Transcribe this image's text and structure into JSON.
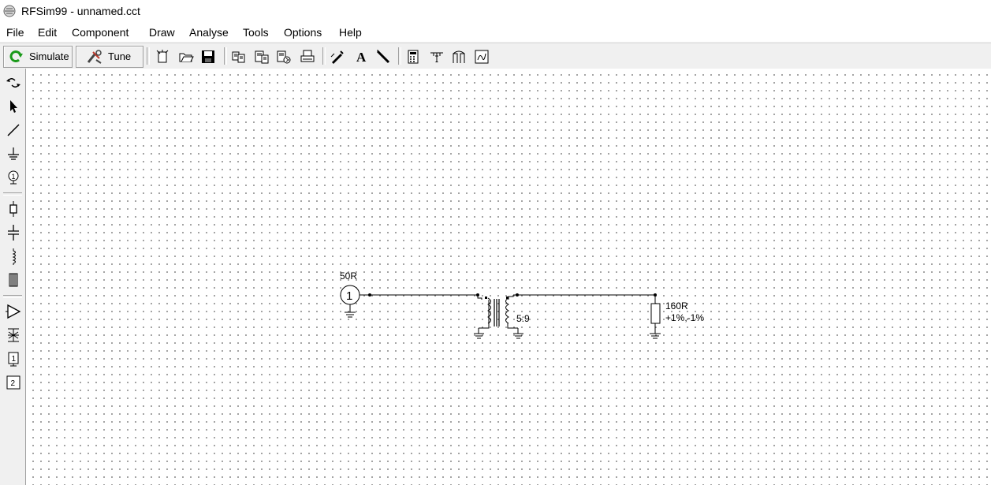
{
  "window": {
    "title": "RFSim99 - unnamed.cct"
  },
  "menu": [
    "File",
    "Edit",
    "Component",
    "Draw",
    "Analyse",
    "Tools",
    "Options",
    "Help"
  ],
  "toolbar": {
    "simulate_label": "Simulate",
    "tune_label": "Tune",
    "icons": [
      "new-icon",
      "open-icon",
      "save-icon",
      "copy-icon",
      "paste-icon",
      "export-icon",
      "print-icon",
      "edit-icon",
      "text-icon",
      "pen-icon",
      "calculator-icon",
      "filter-icon",
      "antenna-icon",
      "chart-icon"
    ]
  },
  "sidebar": {
    "icons": [
      "rotate-icon",
      "pointer-icon",
      "wire-icon",
      "ground-icon",
      "port-icon",
      "resistor-icon",
      "capacitor-icon",
      "inductor-icon",
      "transformer-block-icon",
      "amplifier-icon",
      "crystal-icon",
      "port1-icon",
      "port2-icon"
    ]
  },
  "circuit": {
    "source": {
      "label": "50R",
      "port_number": "1"
    },
    "transformer": {
      "ratio": "5:9"
    },
    "resistor": {
      "value": "160R",
      "tolerance": "+1%,-1%"
    }
  }
}
